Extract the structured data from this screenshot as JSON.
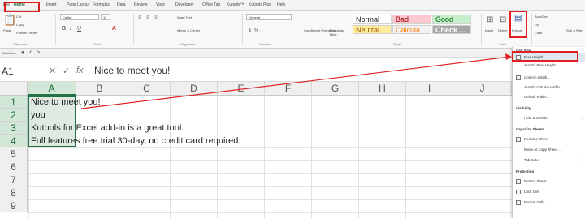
{
  "ribbon_tabs": [
    "File",
    "Home",
    "Insert",
    "Page Layout",
    "Formulas",
    "Data",
    "Review",
    "View",
    "Developer",
    "Office Tab",
    "Kutools™",
    "Kutools Plus",
    "Help"
  ],
  "clipboard": {
    "paste": "Paste",
    "cut": "Cut",
    "copy": "Copy",
    "format_painter": "Format Painter",
    "group": "Clipboard"
  },
  "font": {
    "name": "Calibri",
    "size": "11",
    "group": "Font"
  },
  "alignment": {
    "wrap_text": "Wrap Text",
    "merge_center": "Merge & Center",
    "group": "Alignment"
  },
  "number": {
    "format": "General",
    "group": "Number"
  },
  "styles": {
    "conditional_formatting": "Conditional Formatting",
    "format_as_table": "Format as Table",
    "cells": [
      {
        "label": "Normal",
        "bg": "#ffffff",
        "fg": "#222222"
      },
      {
        "label": "Bad",
        "bg": "#ffc7ce",
        "fg": "#9c0006"
      },
      {
        "label": "Good",
        "bg": "#c6efce",
        "fg": "#006100"
      },
      {
        "label": "Neutral",
        "bg": "#ffeb9c",
        "fg": "#9c5700"
      },
      {
        "label": "Calcula...",
        "bg": "#f2f2f2",
        "fg": "#fa7d00"
      },
      {
        "label": "Check ...",
        "bg": "#a5a5a5",
        "fg": "#ffffff"
      }
    ],
    "group": "Styles"
  },
  "cells_group": {
    "insert": "Insert",
    "delete": "Delete",
    "format": "Format",
    "group": "Cells"
  },
  "editing": {
    "autosum": "AutoSum",
    "fill": "Fill",
    "clear": "Clear",
    "sort_filter": "Sort & Filter"
  },
  "quick_access": {
    "autosave": "AutoSave"
  },
  "formula_bar": {
    "name_box": "A1",
    "fx": "fx",
    "content": "Nice to meet you!"
  },
  "columns": [
    "A",
    "B",
    "C",
    "D",
    "E",
    "F",
    "G",
    "H",
    "I",
    "J"
  ],
  "rows": [
    "1",
    "2",
    "3",
    "4",
    "5",
    "6",
    "7",
    "8",
    "9"
  ],
  "cells": [
    {
      "row": "1",
      "text": "Nice to meet you!"
    },
    {
      "row": "2",
      "text": "you"
    },
    {
      "row": "3",
      "text": "Kutools for Excel add-in is a great tool."
    },
    {
      "row": "4",
      "text": "Full features free trial 30-day, no credit card required."
    }
  ],
  "format_menu": {
    "header_cell_size": "Cell Size",
    "row_height": "Row Height...",
    "autofit_row": "AutoFit Row Height",
    "column_width": "Column Width...",
    "autofit_column": "AutoFit Column Width",
    "default_width": "Default Width...",
    "header_visibility": "Visibility",
    "hide_unhide": "Hide & Unhide",
    "header_organize": "Organize Sheets",
    "rename_sheet": "Rename Sheet",
    "move_copy": "Move or Copy Sheet...",
    "tab_color": "Tab Color",
    "header_protection": "Protection",
    "protect_sheet": "Protect Sheet...",
    "lock_cell": "Lock Cell",
    "format_cells": "Format Cells..."
  },
  "colors": {
    "accent": "#217346",
    "highlight_red": "#e02020",
    "selection": "#d9e8dd"
  }
}
